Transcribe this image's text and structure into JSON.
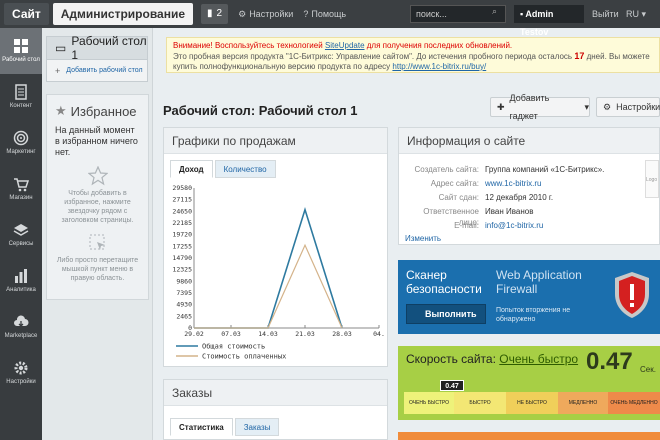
{
  "topbar": {
    "site_label": "Сайт",
    "admin_label": "Администрирование",
    "notif_count": "2",
    "settings_label": "Настройки",
    "help_label": "Помощь",
    "search_placeholder": "поиск...",
    "user_name": "Admin Testov",
    "exit_label": "Выйти",
    "lang": "RU"
  },
  "sidebar": {
    "items": [
      {
        "label": "Рабочий стол",
        "icon": "desktop-icon",
        "active": true
      },
      {
        "label": "Контент",
        "icon": "document-icon"
      },
      {
        "label": "Маркетинг",
        "icon": "target-icon"
      },
      {
        "label": "Магазин",
        "icon": "cart-icon"
      },
      {
        "label": "Сервисы",
        "icon": "layers-icon"
      },
      {
        "label": "Аналитика",
        "icon": "bar-chart-icon"
      },
      {
        "label": "Marketplace",
        "icon": "cloud-download-icon"
      },
      {
        "label": "Настройки",
        "icon": "gear-icon"
      }
    ]
  },
  "favorites": {
    "desktop_label": "Рабочий стол 1",
    "add_desktop_label": "Добавить рабочий стол",
    "title": "Избранное",
    "empty_text": "На данный момент в избранном ничего нет.",
    "hint_star": "Чтобы добавить в избранное, нажмите звездочку рядом с заголовком страницы.",
    "hint_drag": "Либо просто перетащите мышкой пункт меню в правую область."
  },
  "notice": {
    "line1_warn": "Внимание! Воспользуйтесь технологией",
    "line1_link": "SiteUpdate",
    "line1_end": "для получения последних обновлений.",
    "line2_start": "Это пробная версия продукта \"1С-Битрикс: Управление сайтом\". До истечения пробного периода осталось",
    "days": "17",
    "line2_end": "дней. Вы можете купить полнофункциональную версию продукта по адресу",
    "url": "http://www.1c-bitrix.ru/buy/"
  },
  "page": {
    "title": "Рабочий стол: Рабочий стол 1",
    "add_gadget_label": "Добавить гаджет",
    "settings_label": "Настройки"
  },
  "sales": {
    "title": "Графики по продажам",
    "tab_income": "Доход",
    "tab_quantity": "Количество",
    "legend_total": "Общая стоимость",
    "legend_paid": "Стоимость оплаченных"
  },
  "chart_data": {
    "type": "line",
    "categories": [
      "29.02",
      "07.03",
      "14.03",
      "21.03",
      "28.03",
      "04."
    ],
    "series": [
      {
        "name": "Общая стоимость",
        "color": "#2e7aa0",
        "values": [
          0,
          0,
          0,
          25000,
          0,
          null
        ]
      },
      {
        "name": "Стоимость оплаченных",
        "color": "#d4b38a",
        "values": [
          0,
          0,
          0,
          17500,
          0,
          null
        ]
      }
    ],
    "yticks": [
      0,
      2465,
      4930,
      7395,
      9860,
      12325,
      14790,
      17255,
      19720,
      22185,
      24650,
      27115,
      29580
    ],
    "ylim": [
      0,
      29580
    ]
  },
  "site_info": {
    "title": "Информация о сайте",
    "rows": [
      {
        "label": "Создатель сайта:",
        "value": "Группа компаний «1С-Битрикс».",
        "link": false
      },
      {
        "label": "Адрес сайта:",
        "value": "www.1c-bitrix.ru",
        "link": true
      },
      {
        "label": "Сайт сдан:",
        "value": "12 декабря 2010 г.",
        "link": false
      },
      {
        "label": "Ответственное лицо:",
        "value": "Иван Иванов",
        "link": false
      },
      {
        "label": "E-mail:",
        "value": "info@1c-bitrix.ru",
        "link": true
      }
    ],
    "edit_label": "Изменить",
    "logo_text": "Logo"
  },
  "scanner": {
    "title": "Сканер безопасности",
    "waf": "Web Application Firewall",
    "button_label": "Выполнить",
    "note": "Попыток вторжения не обнаружено"
  },
  "speed": {
    "title": "Скорость сайта:",
    "status": "Очень быстро",
    "value": "0.47",
    "unit": "Сек.",
    "marker": "0.47",
    "segments": [
      "ОЧЕНЬ БЫСТРО",
      "БЫСТРО",
      "НЕ БЫСТРО",
      "МЕДЛЕННО",
      "ОЧЕНЬ МЕДЛЕННО"
    ]
  },
  "orders": {
    "title": "Заказы",
    "tab_stats": "Статистика",
    "tab_orders": "Заказы"
  }
}
